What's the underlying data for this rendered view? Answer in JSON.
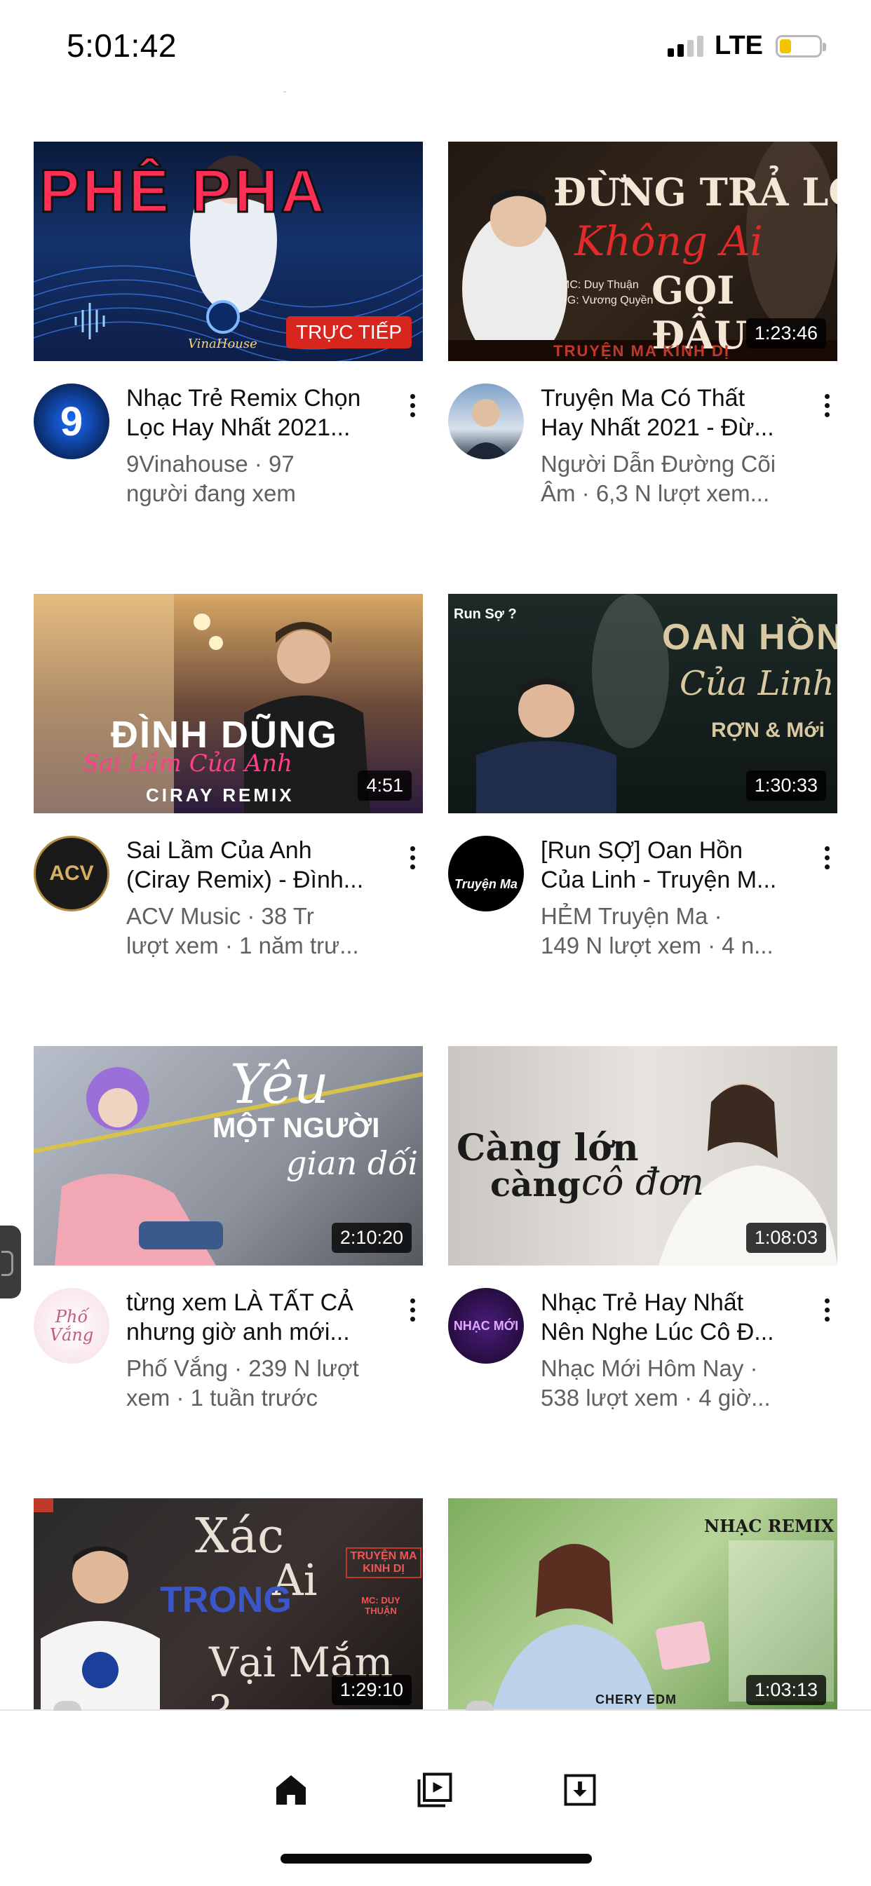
{
  "status_bar": {
    "time": "5:01:42",
    "network": "LTE",
    "battery_level": 0.3
  },
  "videos": [
    {
      "thumb_text": "PHÊ PHA",
      "thumb_sub": "VinaHouse",
      "badge": "TRỰC TIẾP",
      "is_live": true,
      "title_line1": "Nhạc Trẻ Remix Chọn",
      "title_line2": "Lọc Hay Nhất 2021...",
      "sub_line1": "9Vinahouse · 97",
      "sub_line2": "người đang xem",
      "avatar_text": "9"
    },
    {
      "thumb_text": "ĐỪNG TRẢ LỜI",
      "thumb_script": "Không Ai",
      "thumb_text2": "GỌI ĐÂU",
      "thumb_credit1": "MC: Duy Thuận",
      "thumb_credit2": "TG: Vương Quyền",
      "thumb_footer": "TRUYỆN MA KINH DỊ",
      "badge": "1:23:46",
      "is_live": false,
      "title_line1": "Truyện Ma Có Thất",
      "title_line2": "Hay Nhất 2021 - Đừ...",
      "sub_line1": "Người Dẫn Đường Cõi",
      "sub_line2": "Âm · 6,3 N lượt xem...",
      "avatar_text": ""
    },
    {
      "thumb_text": "ĐÌNH DŨNG",
      "thumb_script": "Sai Lầm Của Anh",
      "thumb_text2": "CIRAY REMIX",
      "badge": "4:51",
      "is_live": false,
      "title_line1": "Sai Lầm Của Anh",
      "title_line2": "(Ciray Remix) - Đình...",
      "sub_line1": "ACV Music · 38 Tr",
      "sub_line2": "lượt xem · 1 năm trư...",
      "avatar_text": "ACV"
    },
    {
      "thumb_text": "OAN HỒN",
      "thumb_script": "Của Linh",
      "thumb_text2": "RỢN & Mới",
      "thumb_corner": "Run Sợ ?",
      "badge": "1:30:33",
      "is_live": false,
      "title_line1": "[Run SỢ] Oan Hồn",
      "title_line2": "Của Linh - Truyện M...",
      "sub_line1": "HẺM Truyện Ma ·",
      "sub_line2": "149 N lượt xem · 4 n...",
      "avatar_text": "Truyện Ma"
    },
    {
      "thumb_text": "Yêu",
      "thumb_text2": "MỘT NGƯỜI",
      "thumb_script": "gian dối",
      "badge": "2:10:20",
      "is_live": false,
      "title_line1": "từng xem LÀ TẤT CẢ",
      "title_line2": "nhưng giờ anh mới...",
      "sub_line1": "Phố Vắng · 239 N lượt",
      "sub_line2": "xem · 1 tuần trước",
      "avatar_text": "Phố Vắng"
    },
    {
      "thumb_text": "Càng lớn",
      "thumb_text2": "càng",
      "thumb_script": "cô đơn",
      "badge": "1:08:03",
      "is_live": false,
      "title_line1": "Nhạc Trẻ Hay Nhất",
      "title_line2": "Nên Nghe Lúc Cô Đ...",
      "sub_line1": "Nhạc Mới Hôm Nay ·",
      "sub_line2": "538 lượt xem · 4 giờ...",
      "avatar_text": "NHẠC MỚI"
    },
    {
      "thumb_text": "Xác",
      "thumb_text2": "TRONG",
      "thumb_script": "Ai",
      "thumb_text3": "Vại Mắm ?",
      "thumb_credit1": "TRUYỆN MA KINH DỊ",
      "thumb_credit2": "MC: DUY THUẬN",
      "badge": "1:29:10",
      "is_live": false
    },
    {
      "thumb_text": "NHẠC REMIX",
      "thumb_text2": "CHERY EDM",
      "badge": "1:03:13",
      "is_live": false
    }
  ],
  "nav": {
    "home_icon": "home-icon",
    "subscriptions_icon": "subscriptions-icon",
    "downloads_icon": "downloads-icon"
  },
  "colors": {
    "live_badge": "#d6261d",
    "title_text": "#0f0f0f",
    "sub_text": "#606060",
    "battery_fill": "#f5c400"
  }
}
